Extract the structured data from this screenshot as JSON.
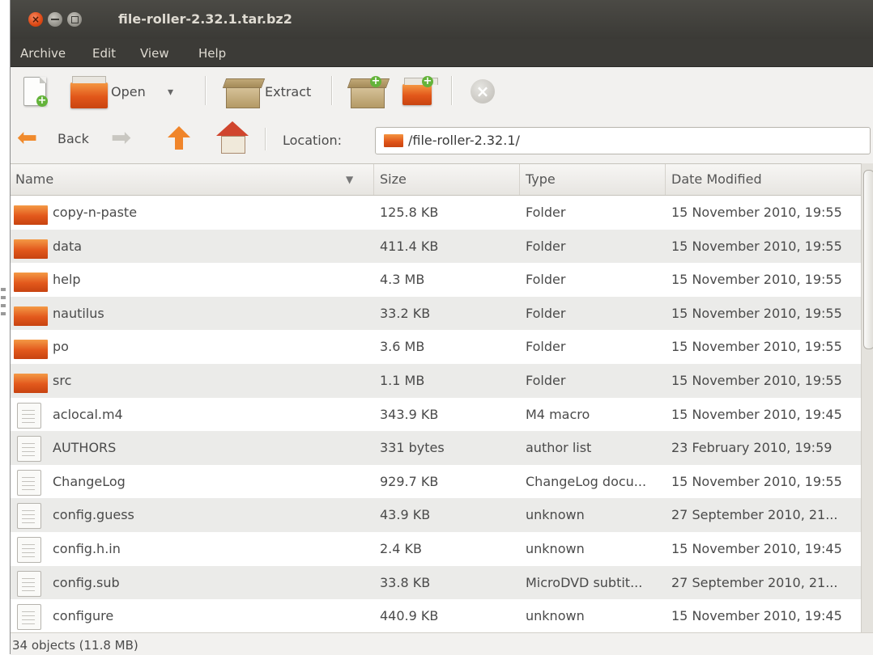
{
  "window": {
    "title": "file-roller-2.32.1.tar.bz2"
  },
  "menu": [
    "Archive",
    "Edit",
    "View",
    "Help"
  ],
  "toolbar": {
    "open_label": "Open",
    "extract_label": "Extract",
    "dropdown_glyph": "▾"
  },
  "nav": {
    "back_label": "Back",
    "location_label": "Location:",
    "location_value": "/file-roller-2.32.1/"
  },
  "columns": [
    "Name",
    "Size",
    "Type",
    "Date Modified"
  ],
  "rows": [
    {
      "name": "copy-n-paste",
      "size": "125.8 KB",
      "type": "Folder",
      "date": "15 November 2010, 19:55",
      "icon": "folder"
    },
    {
      "name": "data",
      "size": "411.4 KB",
      "type": "Folder",
      "date": "15 November 2010, 19:55",
      "icon": "folder"
    },
    {
      "name": "help",
      "size": "4.3 MB",
      "type": "Folder",
      "date": "15 November 2010, 19:55",
      "icon": "folder"
    },
    {
      "name": "nautilus",
      "size": "33.2 KB",
      "type": "Folder",
      "date": "15 November 2010, 19:55",
      "icon": "folder"
    },
    {
      "name": "po",
      "size": "3.6 MB",
      "type": "Folder",
      "date": "15 November 2010, 19:55",
      "icon": "folder"
    },
    {
      "name": "src",
      "size": "1.1 MB",
      "type": "Folder",
      "date": "15 November 2010, 19:55",
      "icon": "folder"
    },
    {
      "name": "aclocal.m4",
      "size": "343.9 KB",
      "type": "M4 macro",
      "date": "15 November 2010, 19:45",
      "icon": "file"
    },
    {
      "name": "AUTHORS",
      "size": "331 bytes",
      "type": "author list",
      "date": "23 February 2010, 19:59",
      "icon": "file"
    },
    {
      "name": "ChangeLog",
      "size": "929.7 KB",
      "type": "ChangeLog docu...",
      "date": "15 November 2010, 19:55",
      "icon": "file"
    },
    {
      "name": "config.guess",
      "size": "43.9 KB",
      "type": "unknown",
      "date": "27 September 2010, 21...",
      "icon": "file"
    },
    {
      "name": "config.h.in",
      "size": "2.4 KB",
      "type": "unknown",
      "date": "15 November 2010, 19:45",
      "icon": "file"
    },
    {
      "name": "config.sub",
      "size": "33.8 KB",
      "type": "MicroDVD subtit...",
      "date": "27 September 2010, 21...",
      "icon": "file"
    },
    {
      "name": "configure",
      "size": "440.9 KB",
      "type": "unknown",
      "date": "15 November 2010, 19:45",
      "icon": "file"
    }
  ],
  "status": "34 objects (11.8 MB)",
  "colors": {
    "accent": "#e2581c",
    "titlebar": "#3c3b37",
    "alt_row": "#ebebe9"
  }
}
